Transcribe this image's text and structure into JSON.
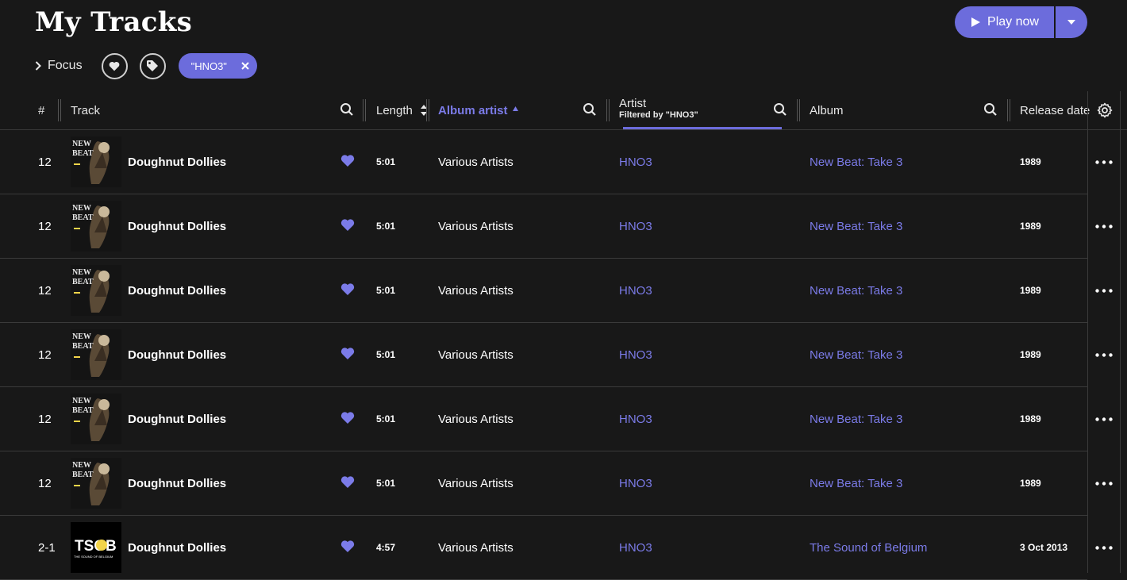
{
  "page": {
    "title": "My Tracks"
  },
  "play": {
    "label": "Play now"
  },
  "filters": {
    "focus_label": "Focus",
    "chip_label": "\"HNO3\""
  },
  "columns": {
    "num": "#",
    "track": "Track",
    "length": "Length",
    "album_artist": "Album artist",
    "artist": "Artist",
    "artist_filter": "Filtered by \"HNO3\"",
    "album": "Album",
    "release_date": "Release date"
  },
  "colors": {
    "accent": "#6c6cdc",
    "link": "#7b7be8",
    "background": "#181818"
  },
  "rows": [
    {
      "num": "12",
      "track": "Doughnut Dollies",
      "length": "5:01",
      "album_artist": "Various Artists",
      "artist": "HNO3",
      "album": "New Beat: Take 3",
      "release_date": "1989",
      "liked": true,
      "cover": "new-beat-cover"
    },
    {
      "num": "12",
      "track": "Doughnut Dollies",
      "length": "5:01",
      "album_artist": "Various Artists",
      "artist": "HNO3",
      "album": "New Beat: Take 3",
      "release_date": "1989",
      "liked": true,
      "cover": "new-beat-cover"
    },
    {
      "num": "12",
      "track": "Doughnut Dollies",
      "length": "5:01",
      "album_artist": "Various Artists",
      "artist": "HNO3",
      "album": "New Beat: Take 3",
      "release_date": "1989",
      "liked": true,
      "cover": "new-beat-cover"
    },
    {
      "num": "12",
      "track": "Doughnut Dollies",
      "length": "5:01",
      "album_artist": "Various Artists",
      "artist": "HNO3",
      "album": "New Beat: Take 3",
      "release_date": "1989",
      "liked": true,
      "cover": "new-beat-cover"
    },
    {
      "num": "12",
      "track": "Doughnut Dollies",
      "length": "5:01",
      "album_artist": "Various Artists",
      "artist": "HNO3",
      "album": "New Beat: Take 3",
      "release_date": "1989",
      "liked": true,
      "cover": "new-beat-cover"
    },
    {
      "num": "12",
      "track": "Doughnut Dollies",
      "length": "5:01",
      "album_artist": "Various Artists",
      "artist": "HNO3",
      "album": "New Beat: Take 3",
      "release_date": "1989",
      "liked": true,
      "cover": "new-beat-cover"
    },
    {
      "num": "2-1",
      "track": "Doughnut Dollies",
      "length": "4:57",
      "album_artist": "Various Artists",
      "artist": "HNO3",
      "album": "The Sound of Belgium",
      "release_date": "3 Oct 2013",
      "liked": true,
      "cover": "tsob-cover"
    }
  ],
  "covers": {
    "new_beat_text_1": "NEW",
    "new_beat_text_2": "BEAT",
    "tsob_text": "TSOB",
    "tsob_sub": "THE SOUND OF BELGIUM"
  }
}
